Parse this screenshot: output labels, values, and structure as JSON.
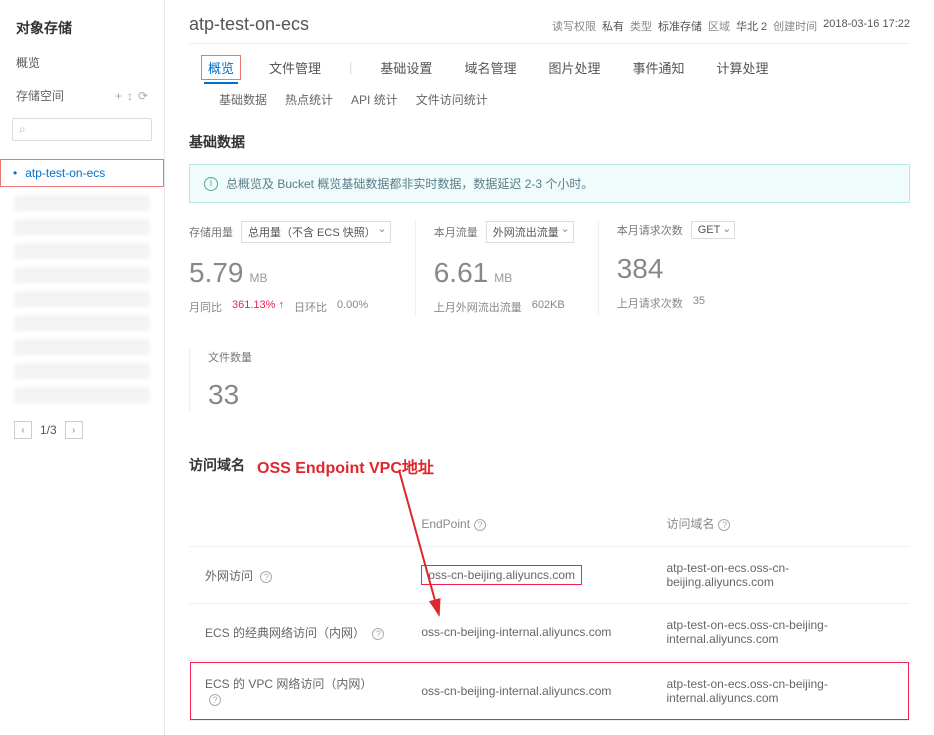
{
  "sidebar": {
    "title": "对象存储",
    "overview": "概览",
    "storage": "存储空间",
    "bucket_active": "atp-test-on-ecs",
    "pager_text": "1/3"
  },
  "header": {
    "bucket_name": "atp-test-on-ecs",
    "perm_label": "读写权限",
    "perm_val": "私有",
    "type_label": "类型",
    "type_val": "标准存储",
    "region_label": "区域",
    "region_val": "华北 2",
    "created_label": "创建时间",
    "created_val": "2018-03-16 17:22"
  },
  "tabs": [
    "概览",
    "文件管理",
    "基础设置",
    "域名管理",
    "图片处理",
    "事件通知",
    "计算处理"
  ],
  "subtabs": [
    "基础数据",
    "热点统计",
    "API 统计",
    "文件访问统计"
  ],
  "basic_data_title": "基础数据",
  "notice_text": "总概览及 Bucket 概览基础数据都非实时数据，数据延迟 2-3 个小时。",
  "stats": {
    "storage": {
      "label": "存储用量",
      "select": "总用量（不含 ECS 快照）",
      "num": "5.79",
      "unit": "MB",
      "mom_label": "月同比",
      "mom_val": "361.13%",
      "dod_label": "日环比",
      "dod_val": "0.00%"
    },
    "traffic": {
      "label": "本月流量",
      "select": "外网流出流量",
      "num": "6.61",
      "unit": "MB",
      "foot_label": "上月外网流出流量",
      "foot_val": "602KB"
    },
    "requests": {
      "label": "本月请求次数",
      "select": "GET",
      "num": "384",
      "foot_label": "上月请求次数",
      "foot_val": "35"
    },
    "files": {
      "label": "文件数量",
      "num": "33"
    }
  },
  "domain_section": {
    "title": "访问域名",
    "annotation": "OSS Endpoint VPC地址",
    "col_type": "",
    "col_endpoint": "EndPoint",
    "col_domain": "访问域名",
    "rows": [
      {
        "type": "外网访问",
        "endpoint": "oss-cn-beijing.aliyuncs.com",
        "domain": "atp-test-on-ecs.oss-cn-beijing.aliyuncs.com",
        "ep_boxed": true,
        "row_boxed": false
      },
      {
        "type": "ECS 的经典网络访问（内网）",
        "endpoint": "oss-cn-beijing-internal.aliyuncs.com",
        "domain": "atp-test-on-ecs.oss-cn-beijing-internal.aliyuncs.com",
        "ep_boxed": false,
        "row_boxed": false
      },
      {
        "type": "ECS 的 VPC 网络访问（内网）",
        "endpoint": "oss-cn-beijing-internal.aliyuncs.com",
        "domain": "atp-test-on-ecs.oss-cn-beijing-internal.aliyuncs.com",
        "ep_boxed": false,
        "row_boxed": true
      }
    ]
  }
}
